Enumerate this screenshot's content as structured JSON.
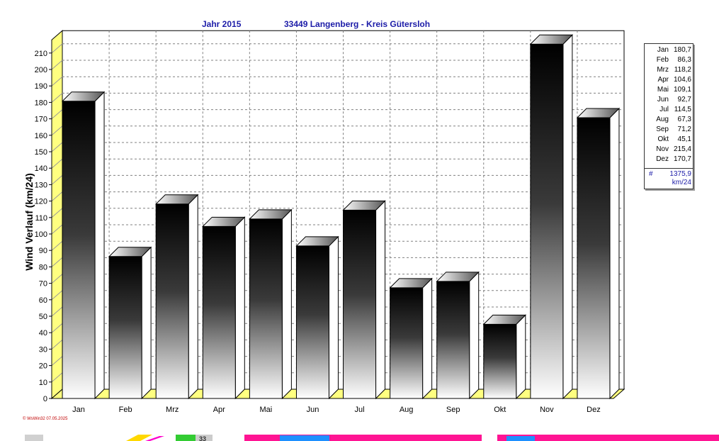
{
  "header": {
    "year_label": "Jahr  2015",
    "location_label": "33449 Langenberg - Kreis Gütersloh"
  },
  "chart_data": {
    "type": "bar",
    "categories": [
      "Jan",
      "Feb",
      "Mrz",
      "Apr",
      "Mai",
      "Jun",
      "Jul",
      "Aug",
      "Sep",
      "Okt",
      "Nov",
      "Dez"
    ],
    "values": [
      180.7,
      86.3,
      118.2,
      104.6,
      109.1,
      92.7,
      114.5,
      67.3,
      71.2,
      45.1,
      215.4,
      170.7
    ],
    "ylabel": "Wind Verlauf  (km/24)",
    "ylim": [
      0,
      218
    ],
    "yticks": [
      0,
      10,
      20,
      30,
      40,
      50,
      60,
      70,
      80,
      90,
      100,
      110,
      120,
      130,
      140,
      150,
      160,
      170,
      180,
      190,
      200,
      210
    ],
    "grid": true,
    "bar_style": "3d-gradient-black-white",
    "legend": "right",
    "legend_entries": [
      {
        "month": "Jan",
        "value": "180,7"
      },
      {
        "month": "Feb",
        "value": "86,3"
      },
      {
        "month": "Mrz",
        "value": "118,2"
      },
      {
        "month": "Apr",
        "value": "104,6"
      },
      {
        "month": "Mai",
        "value": "109,1"
      },
      {
        "month": "Jun",
        "value": "92,7"
      },
      {
        "month": "Jul",
        "value": "114,5"
      },
      {
        "month": "Aug",
        "value": "67,3"
      },
      {
        "month": "Sep",
        "value": "71,2"
      },
      {
        "month": "Okt",
        "value": "45,1"
      },
      {
        "month": "Nov",
        "value": "215,4"
      },
      {
        "month": "Dez",
        "value": "170,7"
      }
    ],
    "total_symbol": "#",
    "total": "1375,9",
    "total_unit": "km/24"
  },
  "footer": {
    "stamp": "© WsWin32  07.05.2025",
    "partial_text": "33"
  },
  "colors": {
    "title": "#1c1ca8",
    "floor": "#ffff80",
    "stamp": "#c00000",
    "grid": "#808080"
  }
}
